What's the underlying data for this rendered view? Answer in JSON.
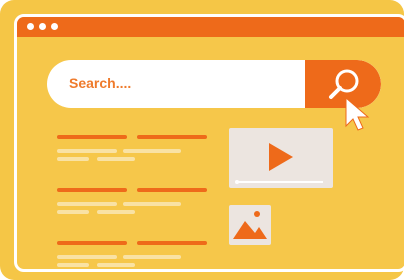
{
  "search": {
    "placeholder": "Search...."
  },
  "colors": {
    "accent": "#ee6a1a",
    "background": "#f6c74a",
    "card": "#ece5e0"
  },
  "icons": {
    "search": "magnifier-icon",
    "cursor": "pointer-cursor-icon",
    "video": "play-icon",
    "image": "image-icon"
  }
}
